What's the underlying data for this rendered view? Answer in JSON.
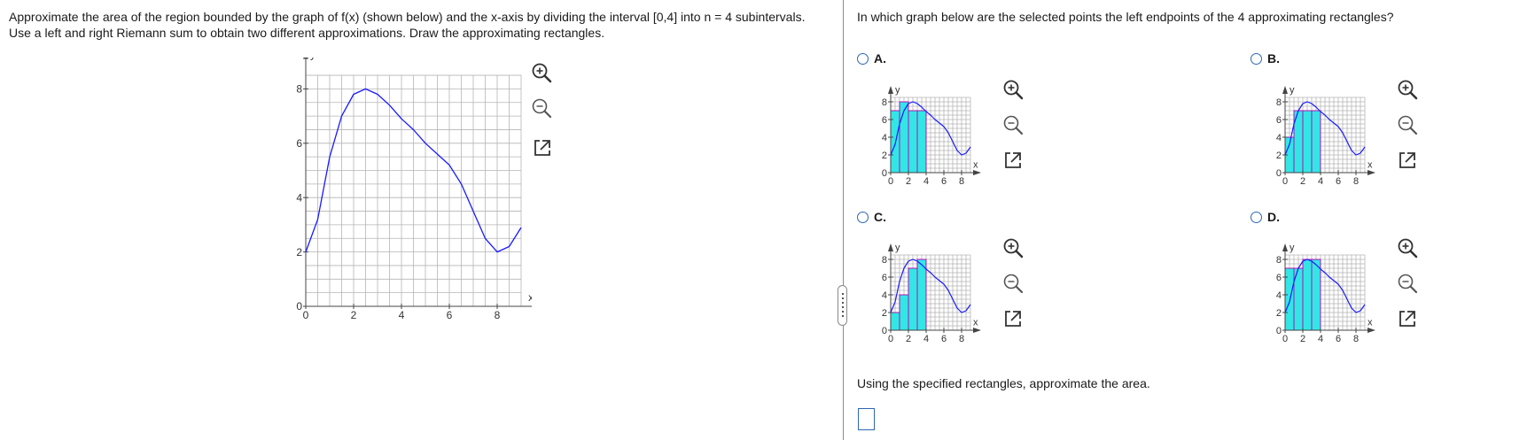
{
  "question_left": "Approximate the area of the region bounded by the graph of f(x) (shown below) and the x-axis by dividing the interval [0,4] into n = 4 subintervals. Use a left and right Riemann sum to obtain two different approximations. Draw the approximating rectangles.",
  "question_right": "In which graph below are the selected points the left endpoints of the 4 approximating rectangles?",
  "area_prompt": "Using the specified rectangles, approximate the area.",
  "area_input_value": "",
  "main_graph": {
    "x_axis_label": "x",
    "y_axis_label": "y",
    "x_ticks": [
      "0",
      "2",
      "4",
      "6",
      "8"
    ],
    "y_ticks": [
      "0",
      "2",
      "4",
      "6",
      "8"
    ]
  },
  "options": [
    {
      "label": "A.",
      "heights": [
        7,
        8,
        7,
        7
      ]
    },
    {
      "label": "B.",
      "heights": [
        4,
        7,
        7,
        7
      ]
    },
    {
      "label": "C.",
      "heights": [
        2,
        4,
        7,
        8
      ]
    },
    {
      "label": "D.",
      "heights": [
        7,
        7,
        8,
        8
      ]
    }
  ],
  "mini_graph": {
    "x_axis_label": "x",
    "y_axis_label": "y",
    "x_ticks": [
      "0",
      "2",
      "4",
      "6",
      "8"
    ],
    "y_ticks": [
      "0",
      "2",
      "4",
      "6",
      "8"
    ]
  },
  "colors": {
    "curve": "#1a1aff",
    "rect_fill": "#33e6e6",
    "rect_stroke": "#b012b0",
    "radio": "#2c66b4",
    "grid": "#b5b5b5"
  },
  "icons": [
    "zoom-in-icon",
    "zoom-out-icon",
    "open-new-window-icon"
  ]
}
